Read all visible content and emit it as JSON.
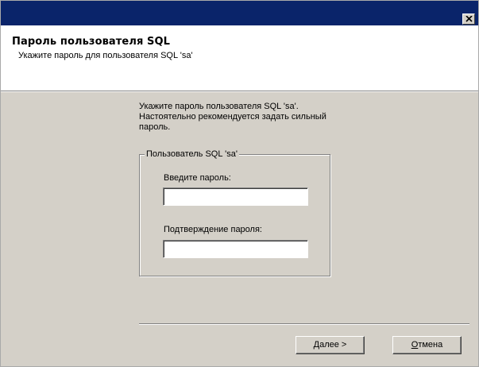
{
  "window": {
    "close_glyph": "✕"
  },
  "header": {
    "title": "Пароль пользователя SQL",
    "subtitle": "Укажите пароль для пользователя SQL 'sa'"
  },
  "description": {
    "line1": "Укажите пароль пользователя SQL 'sa'.",
    "line2": "Настоятельно рекомендуется задать сильный",
    "line3": "пароль."
  },
  "group": {
    "label": "Пользователь SQL 'sa'",
    "password_label": "Введите пароль:",
    "password_value": "",
    "confirm_label": "Подтверждение пароля:",
    "confirm_value": ""
  },
  "buttons": {
    "next_mnemonic": "Д",
    "next_rest": "алее >",
    "cancel_mnemonic": "О",
    "cancel_rest": "тмена"
  },
  "colors": {
    "titlebar": "#0a246a",
    "dialog_face": "#d4d0c8",
    "header_bg": "#ffffff"
  },
  "icons": {
    "close": "close-icon"
  }
}
